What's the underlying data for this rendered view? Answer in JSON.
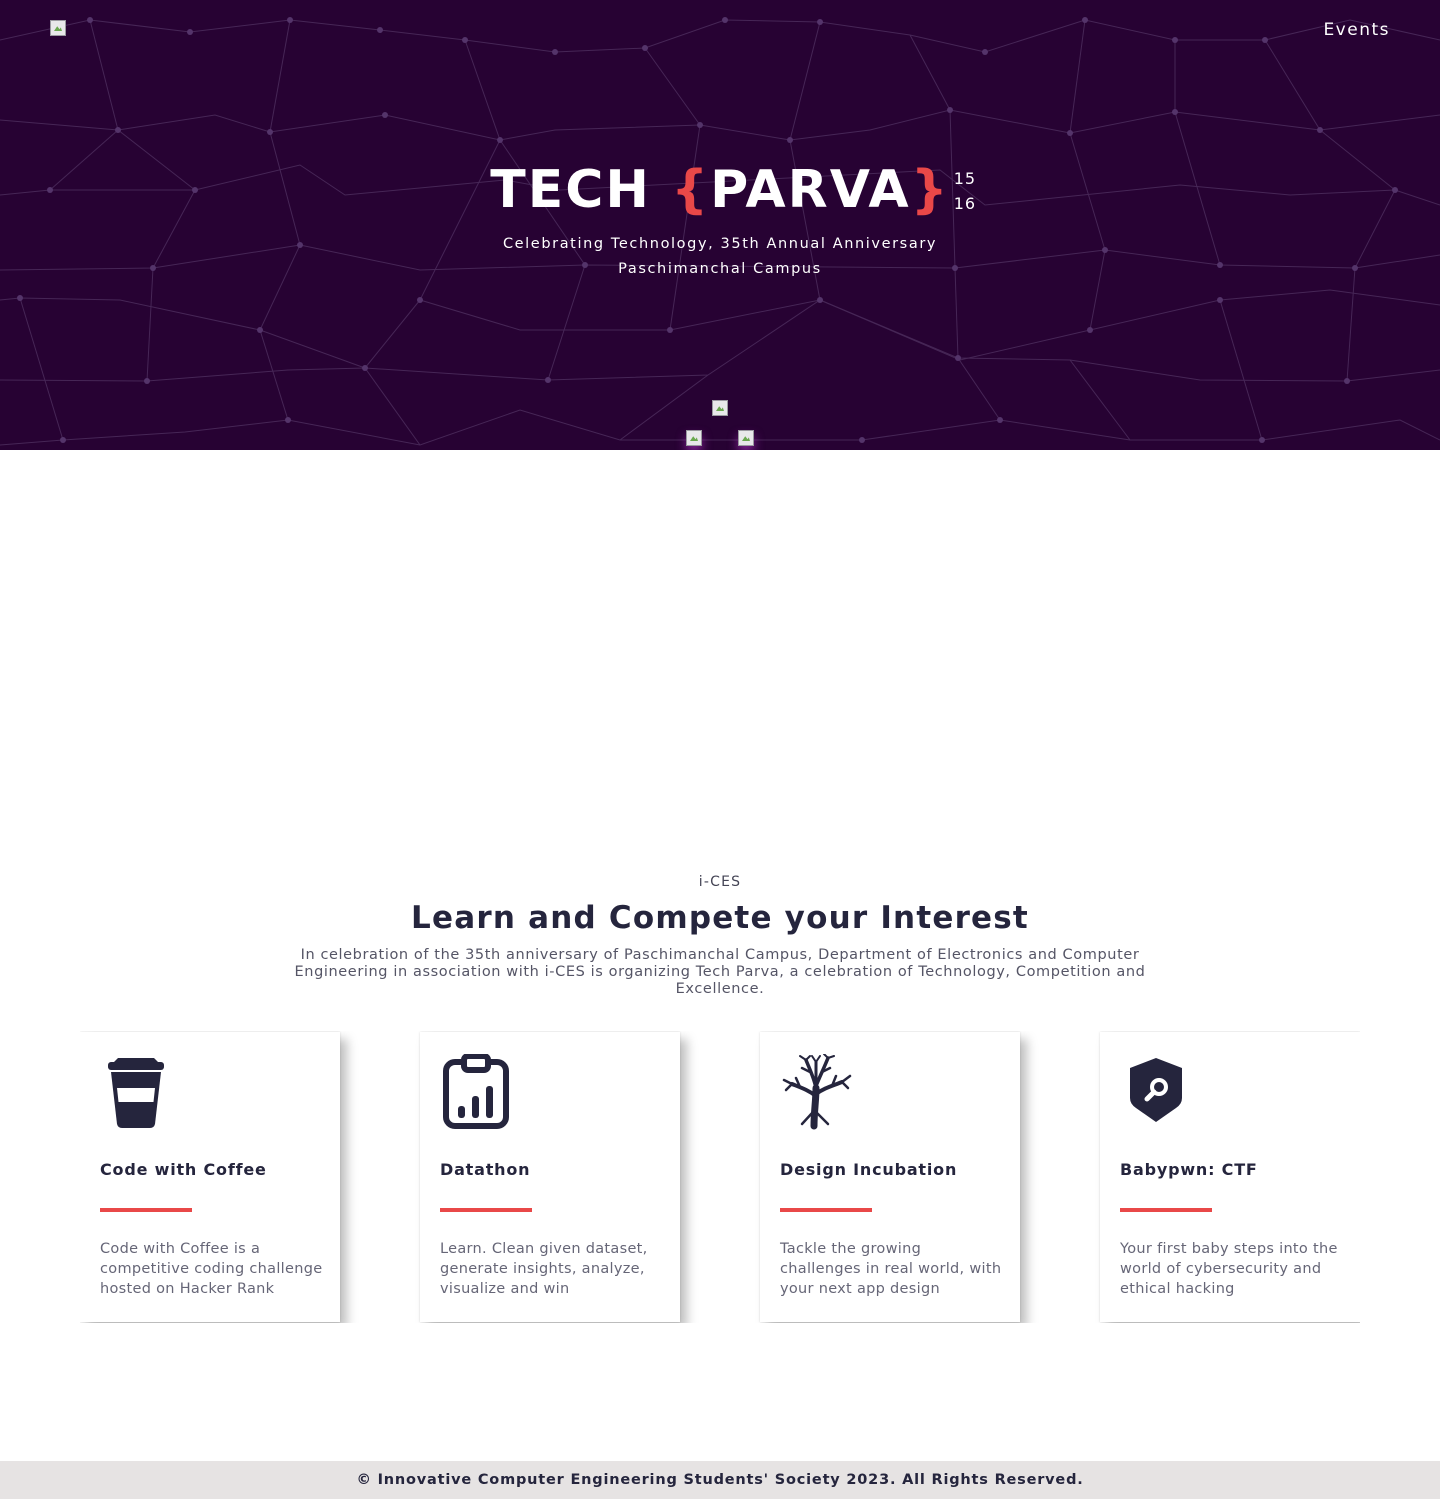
{
  "header": {
    "nav_events": "Events"
  },
  "hero": {
    "title_left": "TECH ",
    "brace_open": "{",
    "title_word": "PARVA",
    "brace_close": "}",
    "date_1": "15",
    "date_2": "16",
    "subtitle_line1": "Celebrating Technology, 35th Annual Anniversary",
    "subtitle_line2": "Paschimanchal Campus"
  },
  "section": {
    "kicker": "i-CES",
    "heading": "Learn and Compete your Interest",
    "intro": "In celebration of the 35th anniversary of Paschimanchal Campus, Department of Electronics and Computer Engineering in association with i-CES is organizing Tech Parva, a celebration of Technology, Competition and Excellence."
  },
  "events": [
    {
      "icon": "coffee-cup-icon",
      "title": "Code with Coffee",
      "description": "Code with Coffee is a competitive coding challenge hosted on Hacker Rank"
    },
    {
      "icon": "clipboard-chart-icon",
      "title": "Datathon",
      "description": "Learn. Clean given dataset, generate insights, analyze, visualize and win"
    },
    {
      "icon": "tree-icon",
      "title": "Design Incubation",
      "description": "Tackle the growing challenges in real world, with your next app design"
    },
    {
      "icon": "shield-search-icon",
      "title": "Babypwn: CTF",
      "description": "Your first baby steps into the world of cybersecurity and ethical hacking"
    }
  ],
  "footer": {
    "copyright": "© Innovative Computer Engineering Students' Society 2023. All Rights Reserved."
  },
  "colors": {
    "hero_bg": "#270233",
    "accent": "#e94848",
    "text_dark": "#25253d",
    "footer_bg": "#e6e3e3"
  }
}
